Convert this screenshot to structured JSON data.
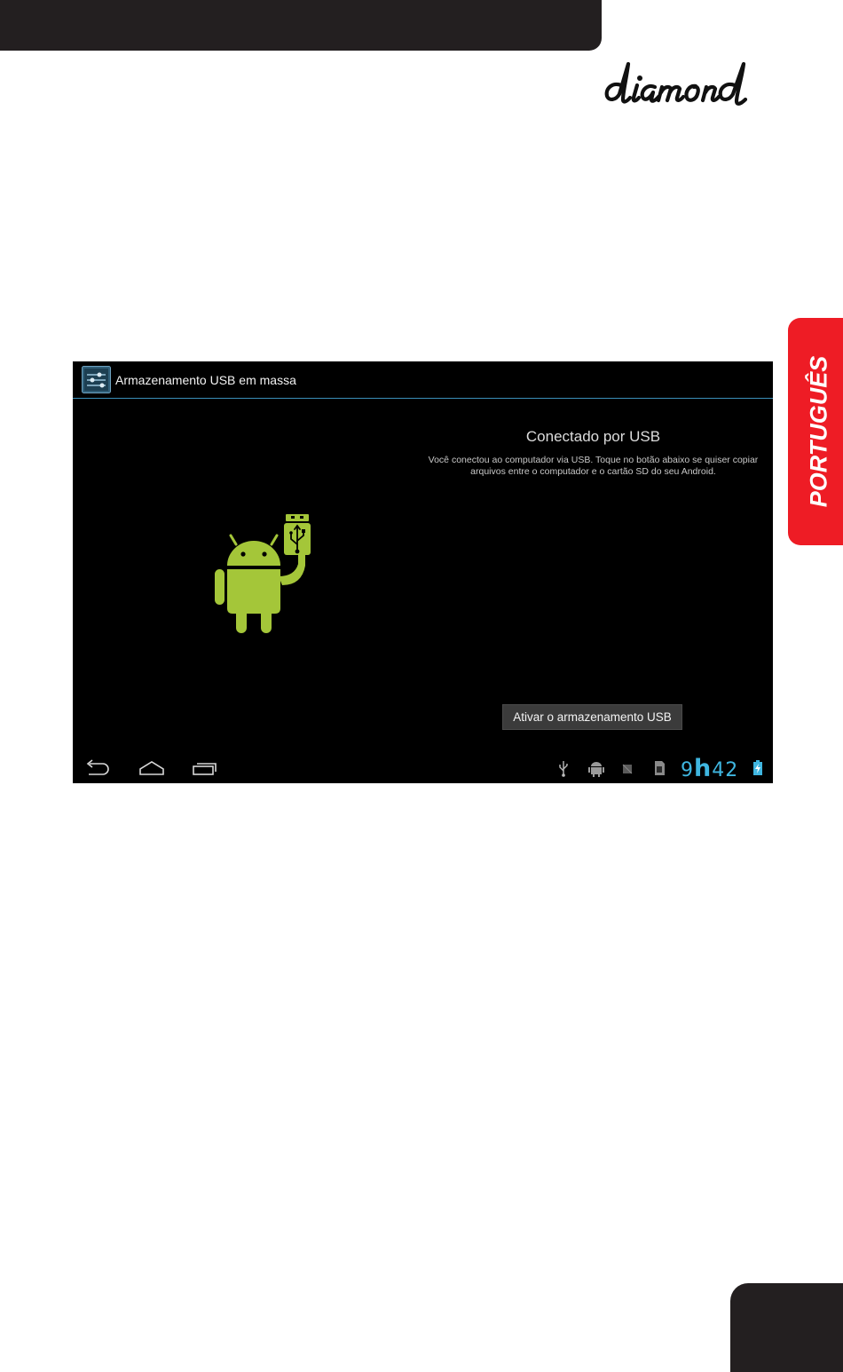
{
  "brand": {
    "logo_text": "diamond"
  },
  "language_tab": {
    "label": "PORTUGUÊS"
  },
  "screen": {
    "action_bar": {
      "title": "Armazenamento USB em massa",
      "icon": "settings-sliders-icon"
    },
    "content": {
      "title": "Conectado por USB",
      "description": "Você conectou ao computador via USB. Toque no botão abaixo se quiser copiar arquivos entre o computador e o cartão SD do seu Android.",
      "button_label": "Ativar o armazenamento USB",
      "illustration": "android-usb-icon"
    },
    "navigation": {
      "back": "back-icon",
      "home": "home-icon",
      "recents": "recents-icon"
    },
    "status_bar": {
      "icons": [
        "usb-icon",
        "android-debug-icon",
        "screenshot-icon",
        "sd-card-icon"
      ],
      "clock_hour": "9",
      "clock_separator": "h",
      "clock_minutes": "42",
      "battery": "battery-charging-icon",
      "accent_color": "#3fb6e0"
    }
  },
  "colors": {
    "header_dark": "#231f20",
    "tab_red": "#ee1c25",
    "android_green": "#a4c639"
  }
}
